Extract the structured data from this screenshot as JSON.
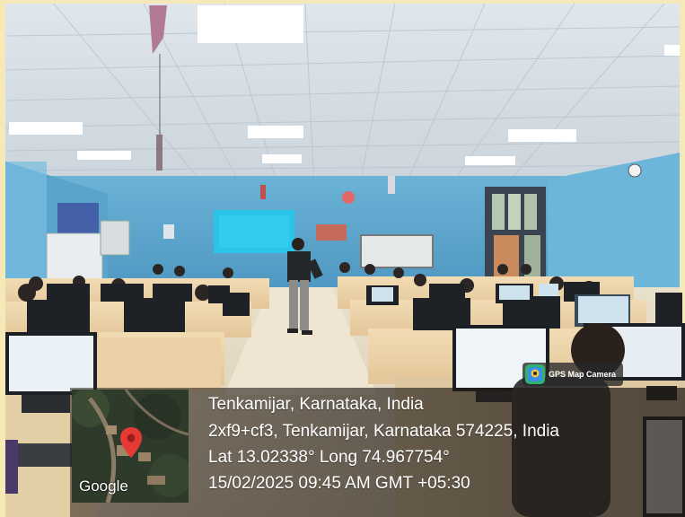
{
  "stamp": {
    "location_title": "Tenkamijar, Karnataka, India",
    "address": "2xf9+cf3, Tenkamijar, Karnataka 574225, India",
    "coordinates": "Lat 13.02338° Long 74.967754°",
    "datetime": "15/02/2025 09:45 AM GMT +05:30"
  },
  "badge": {
    "label": "GPS Map Camera",
    "icon": "camera-pin-icon"
  },
  "map": {
    "attribution": "Google",
    "icon": "location-pin-icon"
  },
  "colors": {
    "frame": "#f6e9b8",
    "wall": "#5fa6cc",
    "pin": "#e53935"
  }
}
